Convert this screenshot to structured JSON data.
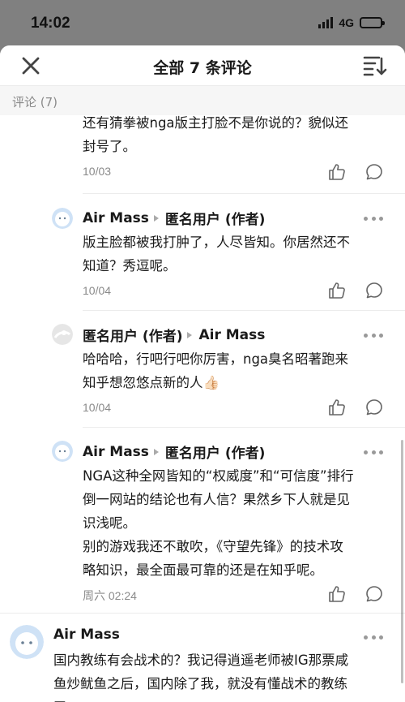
{
  "status_bar": {
    "time": "14:02",
    "network": "4G"
  },
  "header": {
    "title": "全部 7 条评论",
    "close_icon": "close-icon",
    "sort_icon": "sort-icon"
  },
  "section": {
    "label": "评论 (7)"
  },
  "replies": [
    {
      "text": [
        "还有猜拳被nga版主打脸不是你说的？貌似还",
        "封号了。"
      ],
      "time": "10/03"
    },
    {
      "author": "Air Mass",
      "reply_to": "匿名用户 (作者)",
      "text": [
        "版主脸都被我打肿了，人尽皆知。你居然还不",
        "知道？秀逗呢。"
      ],
      "time": "10/04"
    },
    {
      "author": "匿名用户 (作者)",
      "reply_to": "Air Mass",
      "text": [
        "哈哈哈，行吧行吧你厉害，nga臭名昭著跑来",
        "知乎想忽悠点新的人👍🏻"
      ],
      "time": "10/04"
    },
    {
      "author": "Air Mass",
      "reply_to": "匿名用户 (作者)",
      "text": [
        "NGA这种全网皆知的“权威度”和“可信度”排行",
        "倒一网站的结论也有人信？果然乡下人就是见",
        "识浅呢。",
        "别的游戏我还不敢吹，《守望先锋》的技术攻",
        "略知识，最全面最可靠的还是在知乎呢。"
      ],
      "time": "周六 02:24"
    }
  ],
  "main_comment": {
    "author": "Air Mass",
    "text": [
      "国内教练有会战术的？我记得逍遥老师被IG那票咸",
      "鱼炒鱿鱼之后，国内除了我，就没有懂战术的教练",
      "了。"
    ]
  }
}
